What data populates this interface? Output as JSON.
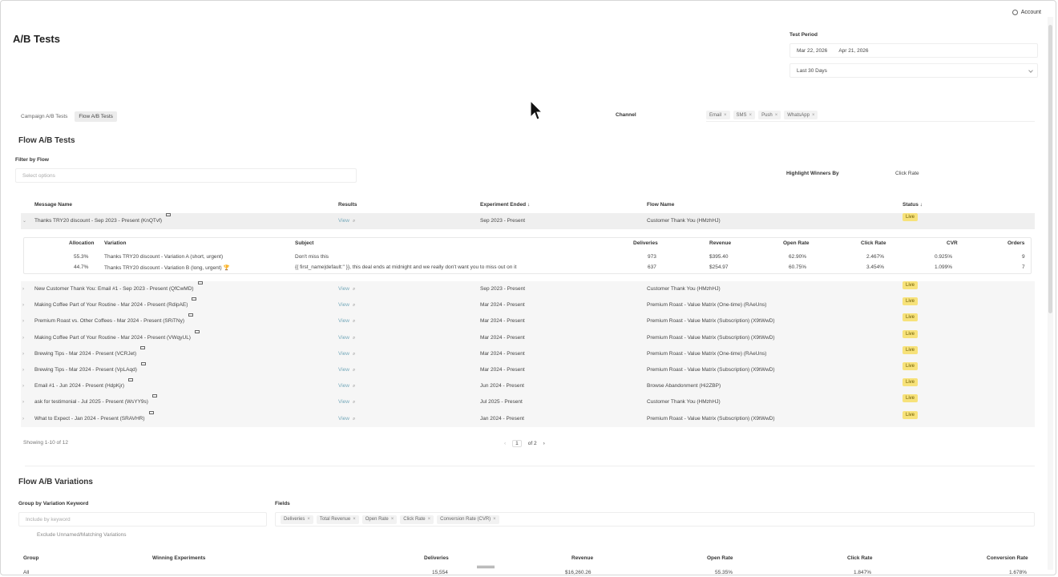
{
  "header": {
    "account_label": "Account",
    "title": "A/B Tests"
  },
  "test_period": {
    "label": "Test Period",
    "start_date": "Mar 22, 2026",
    "end_date": "Apr 21, 2026",
    "preset": "Last 30 Days"
  },
  "tabs": [
    {
      "label": "Campaign A/B Tests",
      "active": false
    },
    {
      "label": "Flow A/B Tests",
      "active": true
    }
  ],
  "channel": {
    "label": "Channel",
    "chips": [
      "Email",
      "SMS",
      "Push",
      "WhatsApp"
    ]
  },
  "flow_tests": {
    "title": "Flow A/B Tests",
    "filter_label": "Filter by Flow",
    "filter_placeholder": "Select options",
    "highlight_label": "Highlight Winners By",
    "highlight_value": "Click Rate",
    "columns": {
      "message_name": "Message Name",
      "results": "Results",
      "experiment_ended": "Experiment Ended ↓",
      "flow_name": "Flow Name",
      "status": "Status ↓"
    },
    "rows": [
      {
        "name": "Thanks TRY20 discount - Sep 2023 - Present (KnQTvf)",
        "results": "View",
        "ended": "Sep 2023 - Present",
        "flow": "Customer Thank You (HMzhHJ)",
        "status": "Live"
      },
      {
        "name": "New Customer Thank You: Email #1 - Sep 2023 - Present (QfCwMD)",
        "results": "View",
        "ended": "Sep 2023 - Present",
        "flow": "Customer Thank You (HMzhHJ)",
        "status": "Live"
      },
      {
        "name": "Making Coffee Part of Your Routine - Mar 2024 - Present (RdipAE)",
        "results": "View",
        "ended": "Mar 2024 - Present",
        "flow": "Premium Roast - Value Matrix (One-time) (RAeUns)",
        "status": "Live"
      },
      {
        "name": "Premium Roast vs. Other Coffees - Mar 2024 - Present (SRiTNy)",
        "results": "View",
        "ended": "Mar 2024 - Present",
        "flow": "Premium Roast - Value Matrix (Subscription) (X9tWwD)",
        "status": "Live"
      },
      {
        "name": "Making Coffee Part of Your Routine - Mar 2024 - Present (VWqyUL)",
        "results": "View",
        "ended": "Mar 2024 - Present",
        "flow": "Premium Roast - Value Matrix (Subscription) (X9tWwD)",
        "status": "Live"
      },
      {
        "name": "Brewing Tips - Mar 2024 - Present (VCRJet)",
        "results": "View",
        "ended": "Mar 2024 - Present",
        "flow": "Premium Roast - Value Matrix (One-time) (RAeUns)",
        "status": "Live"
      },
      {
        "name": "Brewing Tips - Mar 2024 - Present (VpLAqd)",
        "results": "View",
        "ended": "Mar 2024 - Present",
        "flow": "Premium Roast - Value Matrix (Subscription) (X9tWwD)",
        "status": "Live"
      },
      {
        "name": "Email #1 - Jun 2024 - Present (HdpKjr)",
        "results": "View",
        "ended": "Jun 2024 - Present",
        "flow": "Browse Abandonment (Hi2ZBP)",
        "status": "Live"
      },
      {
        "name": "ask for testimonial - Jul 2025 - Present (WsYY9s)",
        "results": "View",
        "ended": "Jul 2025 - Present",
        "flow": "Customer Thank You (HMzhHJ)",
        "status": "Live"
      },
      {
        "name": "What to Expect - Jan 2024 - Present (SRAVHR)",
        "results": "View",
        "ended": "Jan 2024 - Present",
        "flow": "Premium Roast - Value Matrix (Subscription) (X9tWwD)",
        "status": "Live"
      }
    ],
    "expanded": {
      "columns": {
        "allocation": "Allocation",
        "variation": "Variation",
        "subject": "Subject",
        "deliveries": "Deliveries",
        "revenue": "Revenue",
        "open_rate": "Open Rate",
        "click_rate": "Click Rate",
        "cvr": "CVR",
        "orders": "Orders"
      },
      "rows": [
        {
          "allocation": "55.3%",
          "variation": "Thanks TRY20 discount - Variation A (short, urgent)",
          "subject": "Don't miss this",
          "deliveries": "973",
          "revenue": "$395.40",
          "open_rate": "62.90%",
          "click_rate": "2.467%",
          "cvr": "0.925%",
          "orders": "9"
        },
        {
          "allocation": "44.7%",
          "variation": "Thanks TRY20 discount - Variation B (long, urgent)",
          "subject": "{{ first_name|default:'' }}, this deal ends at midnight and we really don't want you to miss out on it",
          "deliveries": "637",
          "revenue": "$254.97",
          "open_rate": "60.75%",
          "click_rate": "3.454%",
          "cvr": "1.099%",
          "orders": "7"
        }
      ]
    },
    "showing": "Showing 1-10 of 12",
    "pager": {
      "prev": "‹",
      "current": "1",
      "of": "of 2",
      "next": "›"
    }
  },
  "variations": {
    "title": "Flow A/B Variations",
    "group_label": "Group by Variation Keyword",
    "group_placeholder": "Include by keyword",
    "exclude_label": "Exclude Unnamed/Matching Variations",
    "fields_label": "Fields",
    "fields": [
      "Deliveries",
      "Total Revenue",
      "Open Rate",
      "Click Rate",
      "Conversion Rate (CVR)"
    ],
    "columns": {
      "group": "Group",
      "winning": "Winning Experiments",
      "deliveries": "Deliveries",
      "revenue": "Revenue",
      "open_rate": "Open Rate",
      "click_rate": "Click Rate",
      "conversion_rate": "Conversion Rate"
    },
    "rows": [
      {
        "group": "All",
        "deliveries": "15,554",
        "revenue": "$16,260.26",
        "open_rate": "55.35%",
        "click_rate": "1.847%",
        "conversion_rate": "1.678%"
      }
    ]
  }
}
